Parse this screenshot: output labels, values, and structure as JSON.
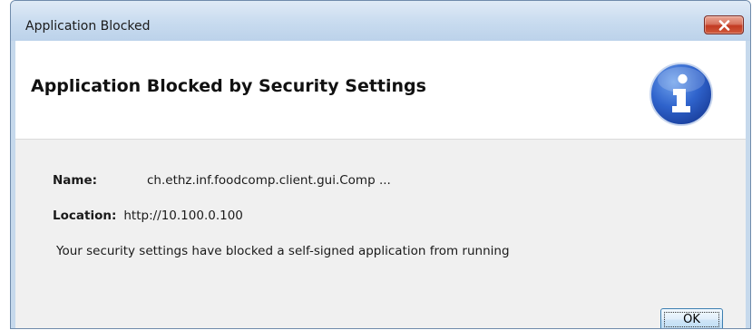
{
  "window": {
    "title": "Application Blocked",
    "close_icon": "close-icon"
  },
  "header": {
    "heading": "Application Blocked by Security Settings",
    "icon": "info-icon",
    "icon_color": "#2b5fc8"
  },
  "details": {
    "name_label": "Name:",
    "name_value": "ch.ethz.inf.foodcomp.client.gui.Comp ...",
    "location_label": "Location:",
    "location_value": "http://10.100.0.100"
  },
  "message": "Your security settings have blocked a self-signed application from running",
  "buttons": {
    "ok_label": "OK"
  }
}
